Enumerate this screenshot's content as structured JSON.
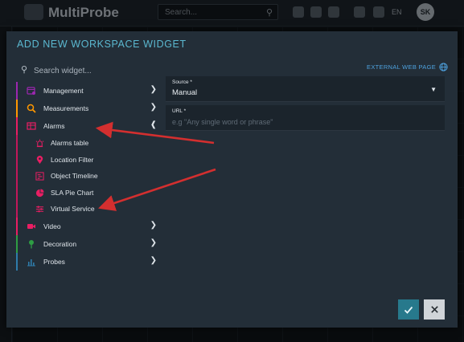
{
  "app": {
    "brand": "MultiProbe",
    "search_placeholder": "Search...",
    "language": "EN",
    "avatar_initials": "SK"
  },
  "modal": {
    "title": "ADD NEW WORKSPACE WIDGET",
    "search_placeholder": "Search widget...",
    "external_link": "EXTERNAL WEB PAGE",
    "categories": [
      {
        "label": "Management",
        "color": "#9c27b0",
        "icon": "calendar-gear-icon",
        "expanded": false
      },
      {
        "label": "Measurements",
        "color": "#ff9800",
        "icon": "magnify-chart-icon",
        "expanded": false
      },
      {
        "label": "Alarms",
        "color": "#e91e63",
        "icon": "alarm-table-icon",
        "expanded": true,
        "items": [
          {
            "label": "Alarms table",
            "icon": "alarm-light-icon"
          },
          {
            "label": "Location Filter",
            "icon": "map-pin-icon"
          },
          {
            "label": "Object Timeline",
            "icon": "timeline-icon"
          },
          {
            "label": "SLA Pie Chart",
            "icon": "pie-chart-icon"
          },
          {
            "label": "Virtual Service",
            "icon": "virtual-service-icon"
          }
        ]
      },
      {
        "label": "Video",
        "color": "#e91e63",
        "icon": "video-camera-icon",
        "expanded": false
      },
      {
        "label": "Decoration",
        "color": "#2e9e44",
        "icon": "pin-icon",
        "expanded": false
      },
      {
        "label": "Probes",
        "color": "#2e7cab",
        "icon": "bar-chart-icon",
        "expanded": false
      }
    ],
    "source": {
      "label": "Source *",
      "value": "Manual"
    },
    "url": {
      "label": "URL *",
      "placeholder": "e.g \"Any single word or phrase\""
    },
    "ok_icon": "checkmark-icon",
    "cancel_icon": "close-icon",
    "colors": {
      "accent": "#5bb8d0",
      "link": "#4ea2df",
      "annotation": "#d32f2f",
      "ok": "#27798c"
    }
  }
}
